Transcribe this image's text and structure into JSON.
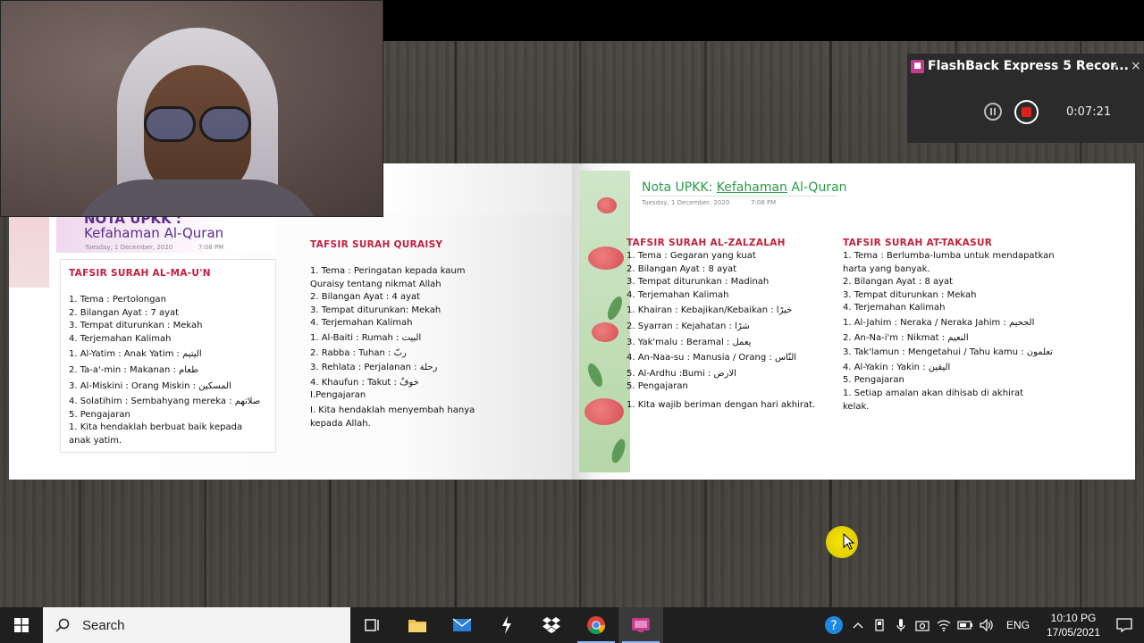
{
  "recorder": {
    "title": "FlashBack Express 5 Recor...",
    "minimize": "–",
    "close": "×",
    "timer": "0:07:21"
  },
  "left_page": {
    "nota_title_1": "NOTA UPKK :",
    "nota_title_2": "Kefahaman Al-Quran",
    "date": "Tuesday, 1 December, 2020",
    "time": "7:08 PM",
    "maun": {
      "title": "TAFSIR SURAH AL-MA-U'N",
      "lines": [
        "1. Tema : Pertolongan",
        "2. Bilangan Ayat : 7 ayat",
        "3. Tempat diturunkan : Mekah",
        "4. Terjemahan Kalimah",
        "1. Al-Yatim : Anak Yatim : اليتيم",
        "2. Ta-a'-min : Makanan : طعام",
        "3. Al-Miskini : Orang Miskin : المسكين",
        "4. Solatihim : Sembahyang mereka : صلاتهم",
        "5. Pengajaran",
        "1. Kita hendaklah berbuat baik kepada",
        "anak yatim."
      ]
    },
    "quraisy": {
      "title": "TAFSIR SURAH QURAISY",
      "lines": [
        "1. Tema : Peringatan kepada kaum",
        "Quraisy tentang nikmat Allah",
        "2. Bilangan Ayat : 4 ayat",
        "3. Tempat diturunkan: Mekah",
        "4. Terjemahan Kalimah",
        "1. Al-Baiti : Rumah : البيت",
        "2. Rabba : Tuhan : ربّ",
        "3. Rehlata : Perjalanan : رحلة",
        "4. Khaufun : Takut : خوفٌ",
        "I.Pengajaran",
        "I. Kita hendaklah menyembah hanya",
        "kepada Allah."
      ]
    }
  },
  "right_page": {
    "nota_prefix": "Nota UPKK: ",
    "nota_keyword": "Kefahaman",
    "nota_suffix": " Al-Quran",
    "date": "Tuesday, 1 December, 2020",
    "time": "7:08 PM",
    "zalzalah": {
      "title": "TAFSIR SURAH AL-ZALZALAH",
      "lines": [
        "1. Tema : Gegaran yang kuat",
        "2. Bilangan Ayat : 8 ayat",
        "3. Tempat diturunkan : Madinah",
        "4. Terjemahan Kalimah",
        "1. Khairan : Kebajikan/Kebaikan : خيرًا",
        "2. Syarran : Kejahatan : شرًا",
        "3. Yak'malu : Beramal : يعمل",
        "4. An-Naa-su : Manusia / Orang : النّاس",
        "5. Al-Ardhu :Bumi : الارض",
        "5. Pengajaran",
        "1. Kita wajib beriman dengan hari akhirat."
      ]
    },
    "takasur": {
      "title": "TAFSIR SURAH AT-TAKASUR",
      "lines": [
        "1. Tema : Berlumba-lumba untuk mendapatkan",
        "harta yang banyak.",
        "2. Bilangan Ayat : 8 ayat",
        "3. Tempat diturunkan : Mekah",
        "4. Terjemahan Kalimah",
        "1. Al-Jahim : Neraka / Neraka Jahim : الجحيم",
        "2. An-Na-i'm : Nikmat : النعيم",
        "3. Tak'lamun : Mengetahui / Tahu kamu : تعلمون",
        "4. Al-Yakin : Yakin : اليقين",
        "5. Pengajaran",
        "1. Setiap amalan akan dihisab di akhirat",
        "kelak."
      ]
    }
  },
  "taskbar": {
    "search_placeholder": "Search",
    "language": "ENG",
    "time": "10:10 PG",
    "date": "17/05/2021"
  },
  "colors": {
    "accent_red": "#c21f3c",
    "accent_green": "#2a9b47",
    "accent_purple": "#5a2d8f",
    "taskbar": "#1f1f1f"
  }
}
